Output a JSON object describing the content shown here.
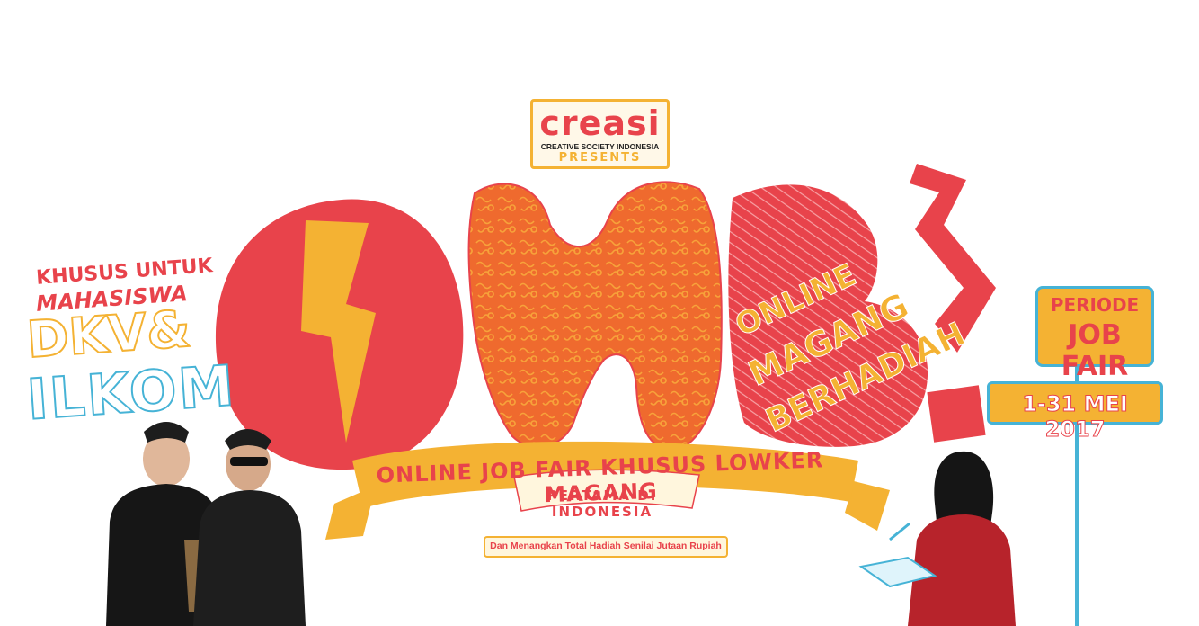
{
  "logo": {
    "name": "creasi",
    "subtitle": "CREATIVE SOCIETY INDONESIA",
    "presents": "PRESENTS"
  },
  "left": {
    "line1": "KHUSUS UNTUK",
    "line2": "MAHASISWA",
    "line3": "DKV&",
    "line4": "ILKOM"
  },
  "omb": {
    "b_lines": [
      "ONLINE",
      "MAGANG",
      "BERHADIAH"
    ]
  },
  "ribbon": {
    "main": "ONLINE JOB FAIR KHUSUS LOWKER MAGANG",
    "sub": "PERTAMA DI INDONESIA",
    "prize": "Dan Menangkan Total Hadiah Senilai Jutaan Rupiah"
  },
  "sign": {
    "label": "PERIODE",
    "title": "JOB FAIR",
    "date": "1-31 MEI 2017"
  },
  "colors": {
    "red": "#e8434b",
    "yellow": "#f4b233",
    "orange": "#ef6a2e",
    "blue": "#46b3d6"
  }
}
